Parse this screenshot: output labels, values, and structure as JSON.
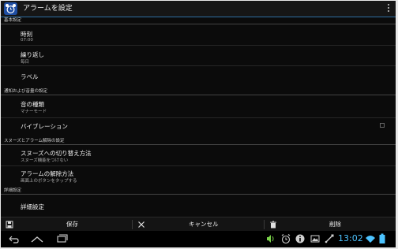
{
  "titlebar": {
    "title": "アラームを設定"
  },
  "sections": {
    "basic": "基本設定",
    "notify": "通知および音量の設定",
    "snooze": "スヌーズとアラーム解除の設定",
    "detail": "詳細設定"
  },
  "rows": {
    "time": {
      "label": "時刻",
      "value": "07:00"
    },
    "repeat": {
      "label": "繰り返し",
      "value": "毎日"
    },
    "label": {
      "label": "ラベル"
    },
    "sound": {
      "label": "音の種類",
      "value": "マナーモード"
    },
    "vibration": {
      "label": "バイブレーション",
      "checked": false
    },
    "snooze_switch": {
      "label": "スヌーズへの切り替え方法",
      "value": "スヌーズ機能をつけない"
    },
    "dismiss": {
      "label": "アラームの解除方法",
      "value": "画面上のボタンをタップする"
    },
    "advanced": {
      "label": "詳細設定"
    }
  },
  "actions": {
    "save": "保存",
    "cancel": "キャンセル",
    "delete": "削除"
  },
  "status": {
    "time": "13:02"
  },
  "colors": {
    "accent": "#4cc3ff",
    "divider": "#2f6fa2",
    "background": "#0b0b0b"
  },
  "icons": {
    "app": "alarm-clock-icon",
    "save": "floppy-disk-icon",
    "cancel": "close-icon",
    "delete": "trash-icon",
    "nav": [
      "back-icon",
      "home-icon",
      "recent-apps-icon"
    ],
    "status": [
      "sound-icon",
      "alarm-icon",
      "info-icon",
      "image-icon",
      "usb-icon",
      "wifi-icon",
      "battery-icon"
    ]
  }
}
